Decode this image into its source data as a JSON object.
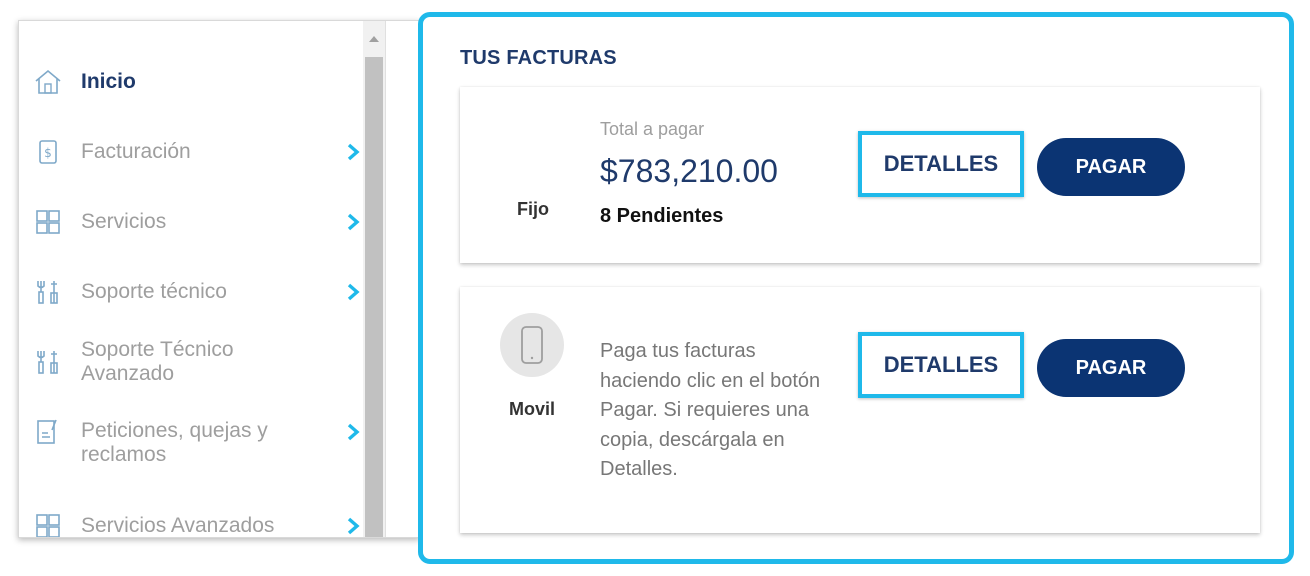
{
  "sidebar": {
    "items": [
      {
        "label": "Inicio",
        "icon": "home-icon",
        "active": true
      },
      {
        "label": "Facturación",
        "icon": "bill-icon"
      },
      {
        "label": "Servicios",
        "icon": "grid-icon"
      },
      {
        "label": "Soporte técnico",
        "icon": "tools-icon"
      },
      {
        "label": "Soporte Técnico Avanzado",
        "icon": "tools-icon"
      },
      {
        "label": "Peticiones, quejas y reclamos",
        "icon": "document-icon"
      },
      {
        "label": "Servicios Avanzados",
        "icon": "grid-icon"
      }
    ]
  },
  "invoices": {
    "title": "TUS FACTURAS",
    "fijo": {
      "type_label": "Fijo",
      "total_caption": "Total a pagar",
      "total_amount": "$783,210.00",
      "pending": "8 Pendientes",
      "details_label": "DETALLES",
      "pay_label": "PAGAR"
    },
    "movil": {
      "type_label": "Movil",
      "info_text": "Paga tus facturas haciendo clic en el botón Pagar. Si requieres una copia, descárgala en Detalles.",
      "details_label": "DETALLES",
      "pay_label": "PAGAR"
    }
  },
  "colors": {
    "accent": "#1fb9ea",
    "brand": "#0b3473",
    "title": "#1f3a6b",
    "muted_text": "#9e9e9e"
  }
}
